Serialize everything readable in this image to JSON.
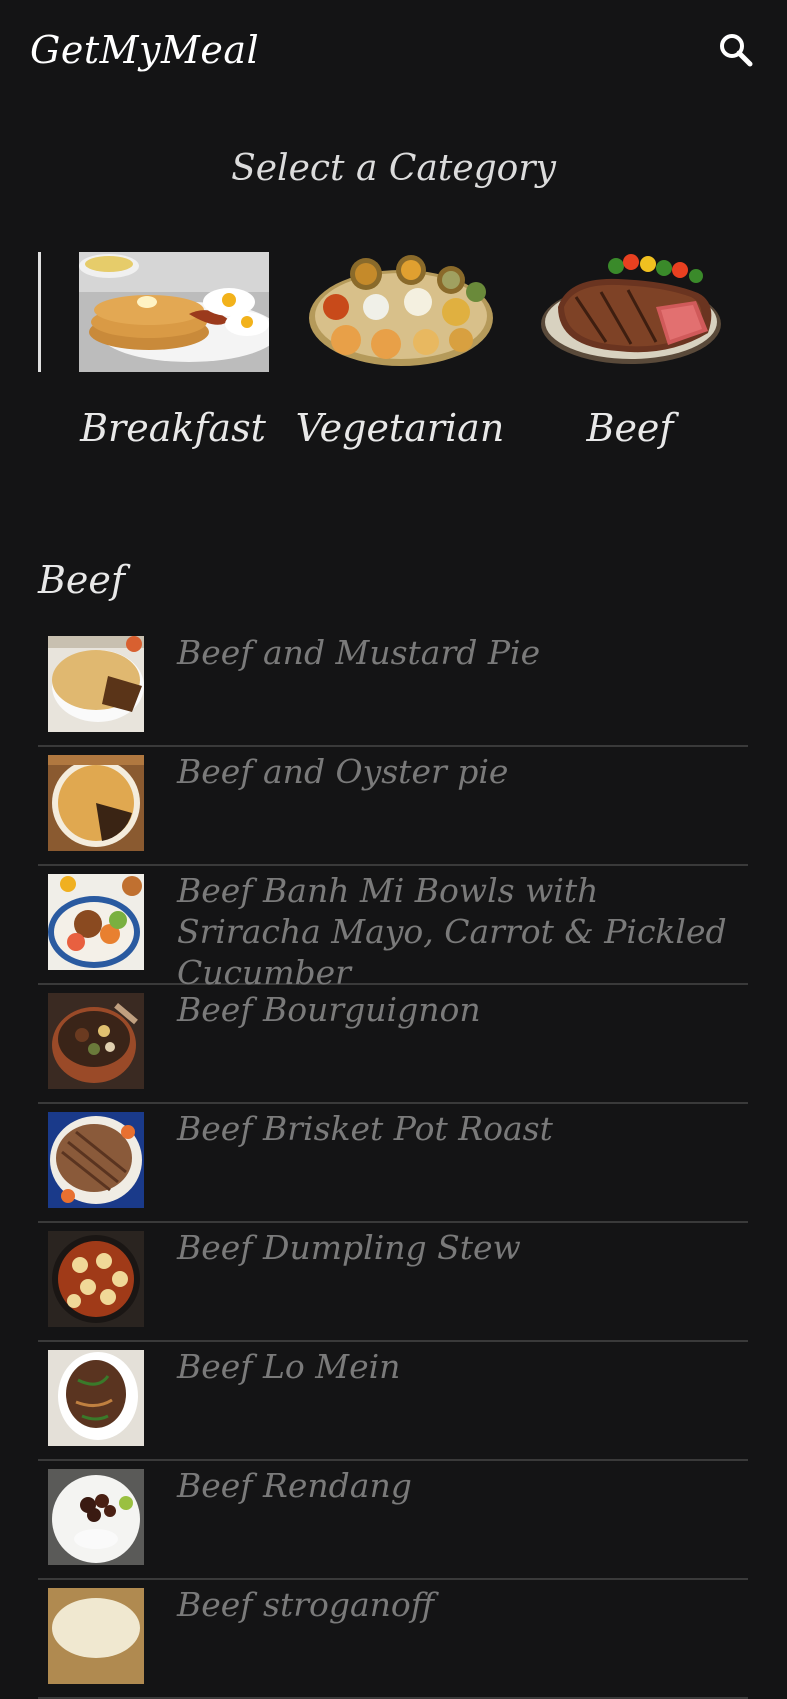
{
  "app": {
    "title": "GetMyMeal"
  },
  "icons": {
    "search": "search-icon"
  },
  "categories_section": {
    "heading": "Select a Category",
    "items": [
      {
        "label": "Breakfast"
      },
      {
        "label": "Vegetarian"
      },
      {
        "label": "Beef"
      }
    ]
  },
  "meals_section": {
    "heading": "Beef",
    "items": [
      {
        "name": "Beef and Mustard Pie"
      },
      {
        "name": "Beef and Oyster pie"
      },
      {
        "name": "Beef Banh Mi Bowls with Sriracha Mayo, Carrot & Pickled Cucumber"
      },
      {
        "name": "Beef Bourguignon"
      },
      {
        "name": "Beef Brisket Pot Roast"
      },
      {
        "name": "Beef Dumpling Stew"
      },
      {
        "name": "Beef Lo Mein"
      },
      {
        "name": "Beef Rendang"
      },
      {
        "name": "Beef stroganoff"
      }
    ]
  },
  "colors": {
    "background": "#141415",
    "primary_text": "#e8e8e8",
    "muted_text": "#7a7a7a",
    "divider": "#3a3a3a"
  }
}
